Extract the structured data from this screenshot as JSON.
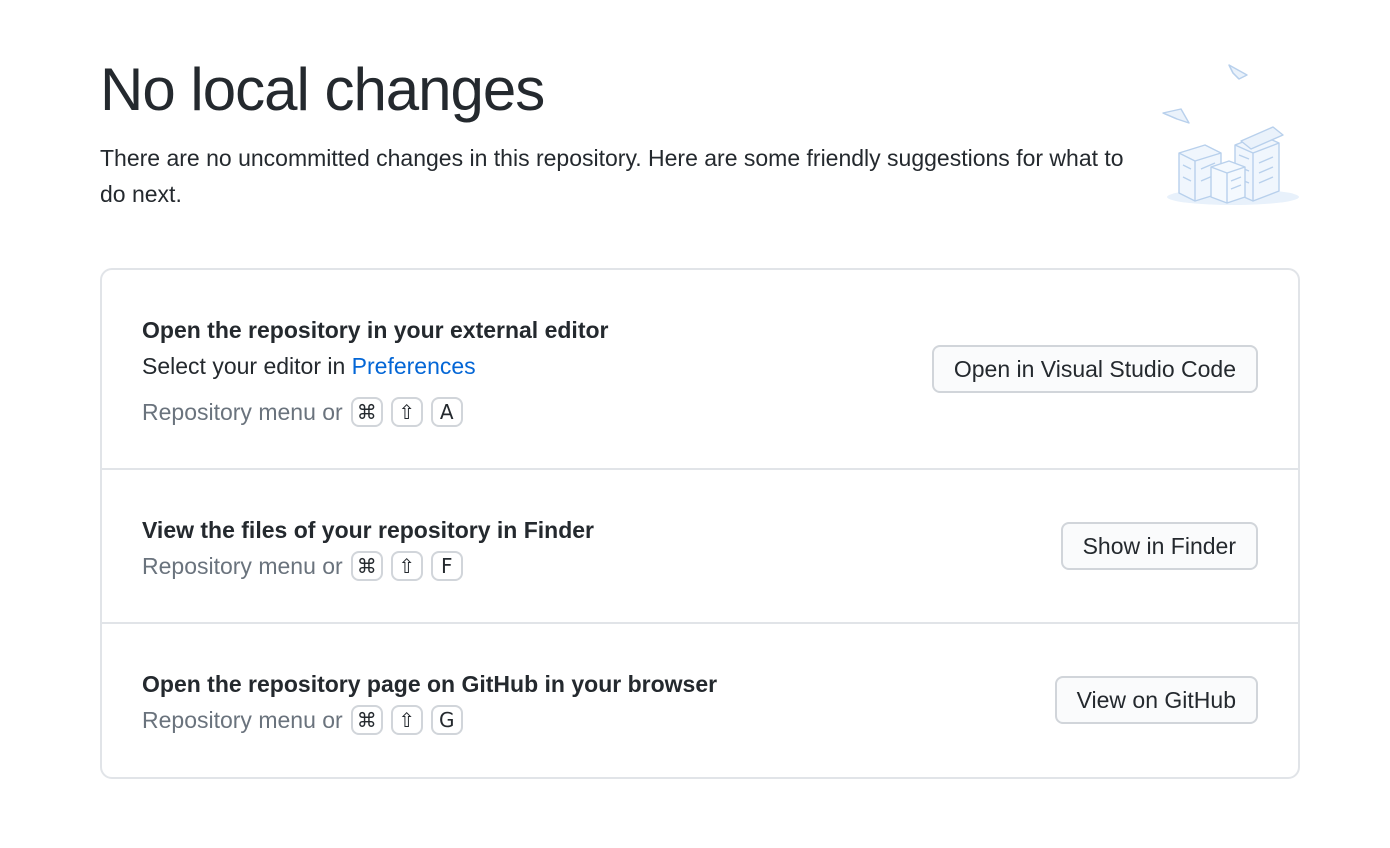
{
  "header": {
    "title": "No local changes",
    "subtitle": "There are no uncommitted changes in this repository. Here are some friendly suggestions for what to do next."
  },
  "illustration": {
    "icon": "empty-repository-illustration",
    "color": "#c8ddf5"
  },
  "actions": [
    {
      "title": "Open the repository in your external editor",
      "description_prefix": "Select your editor in ",
      "description_link": "Preferences",
      "shortcut_prefix": "Repository menu or",
      "keys": [
        "⌘",
        "⇧",
        "A"
      ],
      "button_label": "Open in Visual Studio Code"
    },
    {
      "title": "View the files of your repository in Finder",
      "shortcut_prefix": "Repository menu or",
      "keys": [
        "⌘",
        "⇧",
        "F"
      ],
      "button_label": "Show in Finder"
    },
    {
      "title": "Open the repository page on GitHub in your browser",
      "shortcut_prefix": "Repository menu or",
      "keys": [
        "⌘",
        "⇧",
        "G"
      ],
      "button_label": "View on GitHub"
    }
  ],
  "colors": {
    "text": "#24292e",
    "muted": "#6a737d",
    "link": "#0366d6",
    "border": "#e1e4e8",
    "button_bg": "#fafbfc"
  }
}
